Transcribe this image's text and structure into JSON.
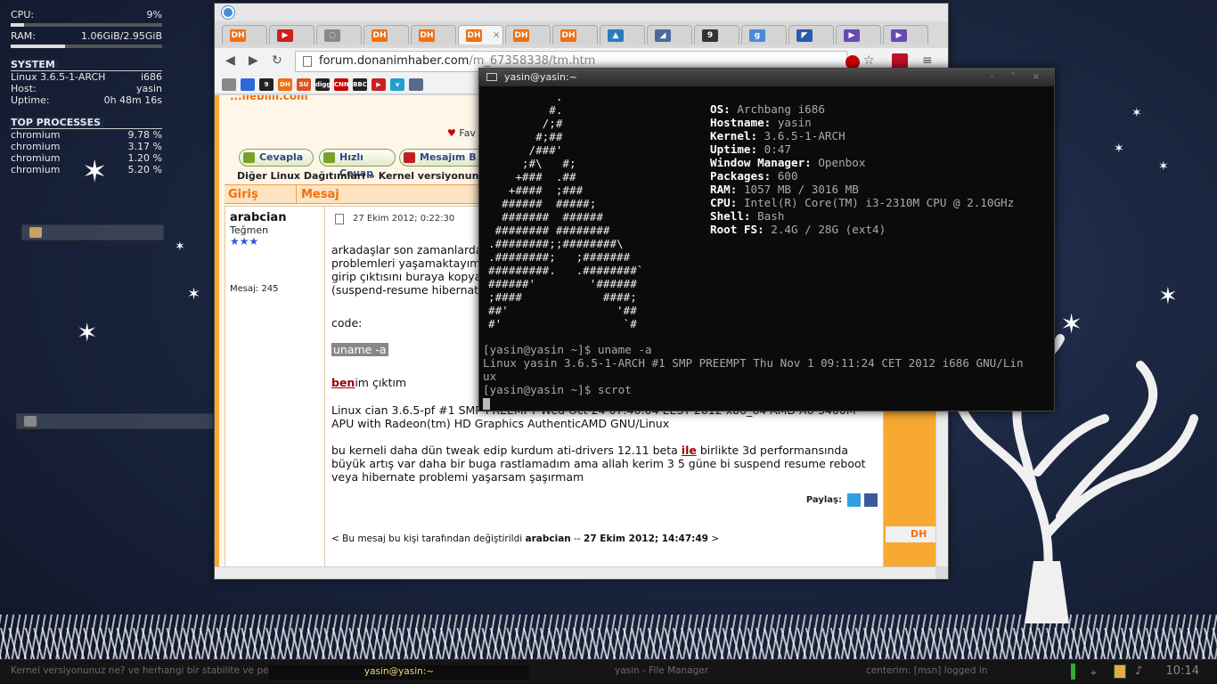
{
  "conky": {
    "cpu_label": "CPU:",
    "cpu_value": "9%",
    "cpu_fraction": 0.09,
    "ram_label": "RAM:",
    "ram_value": "1.06GiB/2.95GiB",
    "ram_fraction": 0.36,
    "system_header": "SYSTEM",
    "kernel": "Linux 3.6.5-1-ARCH",
    "arch": "i686",
    "host_label": "Host:",
    "host_value": "yasin",
    "uptime_label": "Uptime:",
    "uptime_value": "0h 48m 16s",
    "processes_header": "TOP PROCESSES",
    "processes": [
      {
        "name": "chromium",
        "cpu": "9.78 %"
      },
      {
        "name": "chromium",
        "cpu": "3.17 %"
      },
      {
        "name": "chromium",
        "cpu": "1.20 %"
      },
      {
        "name": "chromium",
        "cpu": "5.20 %"
      }
    ]
  },
  "browser": {
    "tabs": [
      {
        "label": "DH",
        "color": "#f07010"
      },
      {
        "label": "▶",
        "color": "#cc2020"
      },
      {
        "label": "◌",
        "color": "#888888"
      },
      {
        "label": "DH",
        "color": "#f07010"
      },
      {
        "label": "DH",
        "color": "#f07010"
      },
      {
        "label": "DH",
        "color": "#f07010",
        "active": true,
        "close": "×"
      },
      {
        "label": "DH",
        "color": "#f07010"
      },
      {
        "label": "DH",
        "color": "#f07010"
      },
      {
        "label": "▲",
        "color": "#2a7ac0"
      },
      {
        "label": "◢",
        "color": "#4a6a9a"
      },
      {
        "label": "9",
        "color": "#333333"
      },
      {
        "label": "g",
        "color": "#4a8ad9"
      },
      {
        "label": "◤",
        "color": "#2a5ab0"
      },
      {
        "label": "▶",
        "color": "#6a4ab0"
      },
      {
        "label": "▶",
        "color": "#6a4ab0"
      }
    ],
    "url_host": "forum.donanimhaber.com",
    "url_path": "/m_67358338/tm.htm",
    "bookmarks": [
      {
        "label": "",
        "color": "#888888"
      },
      {
        "label": "",
        "color": "#2a6ad9"
      },
      {
        "label": "9",
        "color": "#222222"
      },
      {
        "label": "DH",
        "color": "#f07010"
      },
      {
        "label": "SU",
        "color": "#e05020"
      },
      {
        "label": "digg",
        "color": "#222222"
      },
      {
        "label": "CNN",
        "color": "#cc0000"
      },
      {
        "label": "BBC",
        "color": "#222222"
      },
      {
        "label": "▶",
        "color": "#cc2020"
      },
      {
        "label": "v",
        "color": "#20a0d0"
      },
      {
        "label": "",
        "color": "#5a6a8a"
      }
    ],
    "page": {
      "top_cut": "...ilebilir.com",
      "favorites": "Fav",
      "buttons": {
        "reply": "Cevapla",
        "quick_reply": "Hızlı Cevap",
        "message": "Mesajım B"
      },
      "breadcrumb": "Diğer Linux Dağıtımları » Kernel versiyonunuz ne",
      "col_login": "Giriş",
      "col_message": "Mesaj",
      "author": "arabcian",
      "rank": "Teğmen",
      "stars": "★★★",
      "post_count": "Mesaj: 245",
      "date": "27 Ekim 2012; 0:22:30",
      "para1_l1": "arkadaşlar son zamanlarda",
      "para1_l2": "problemleri yaşamaktayım",
      "para1_l3": "girip çıktısını buraya kopya",
      "para1_l4": "(suspend-resume hibernate",
      "code_label": "code:",
      "code": "uname -a",
      "mine_bold": "ben",
      "mine_rest": "im çıktım",
      "output": "Linux cian 3.6.5-pf #1 SMP PREEMPT Wed Oct 24 07:46:04 EEST 2012 x86_64 AMD A6-3400M APU with Radeon(tm) HD Graphics AuthenticAMD GNU/Linux",
      "para2_a": "bu kerneli daha dün tweak edip kurdum ati-drivers 12.11 beta ",
      "para2_link": "ile",
      "para2_b": " birlikte 3d performansında büyük artış var daha bir buga rastlamadım ama allah kerim 3 5 güne bi suspend resume reboot veya hibernate problemi yaşarsam şaşırmam",
      "share": "Paylaş:",
      "edited_prefix": "< Bu mesaj bu kişi tarafından değiştirildi",
      "edited_user": "arabcian",
      "edited_sep": "--",
      "edited_date": "27 Ekim 2012; 14:47:49",
      "edited_suffix": ">",
      "side_link": "DH"
    }
  },
  "terminal": {
    "title": "yasin@yasin:~",
    "ascii_art": "          .\n         #.\n        /;#\n       #;##\n      /###'\n     ;#\\   #;\n    +###  .##\n   +####  ;###\n  ######  #####;\n  #######  ######\n ######## ########\n.########;;########\\\n.########;   ;#######\n#########.   .########`\n######'        '######\n;####            ####;\n##'                '##\n#'                  `#",
    "info": [
      {
        "key": "OS:",
        "value": "Archbang i686"
      },
      {
        "key": "Hostname:",
        "value": "yasin"
      },
      {
        "key": "Kernel:",
        "value": "3.6.5-1-ARCH"
      },
      {
        "key": "Uptime:",
        "value": "0:47"
      },
      {
        "key": "Window Manager:",
        "value": "Openbox"
      },
      {
        "key": "Packages:",
        "value": "600"
      },
      {
        "key": "RAM:",
        "value": "1057 MB / 3016 MB"
      },
      {
        "key": "CPU:",
        "value": "Intel(R) Core(TM) i3-2310M CPU @ 2.10GHz"
      },
      {
        "key": "Shell:",
        "value": "Bash"
      },
      {
        "key": "Root FS:",
        "value": "2.4G / 28G (ext4)"
      }
    ],
    "line1": "[yasin@yasin ~]$ uname -a",
    "line2": "Linux yasin 3.6.5-1-ARCH #1 SMP PREEMPT Thu Nov 1 09:11:24 CET 2012 i686 GNU/Lin",
    "line3": "ux",
    "line4": "[yasin@yasin ~]$ scrot"
  },
  "taskbar": {
    "task1": "Kernel versiyonunuz ne? ve herhangi bir stabilite ve perfor...",
    "task2": "yasin@yasin:~",
    "task3": "yasin - File Manager",
    "task4": "centerim: [msn] logged in",
    "clock": "10:14"
  }
}
